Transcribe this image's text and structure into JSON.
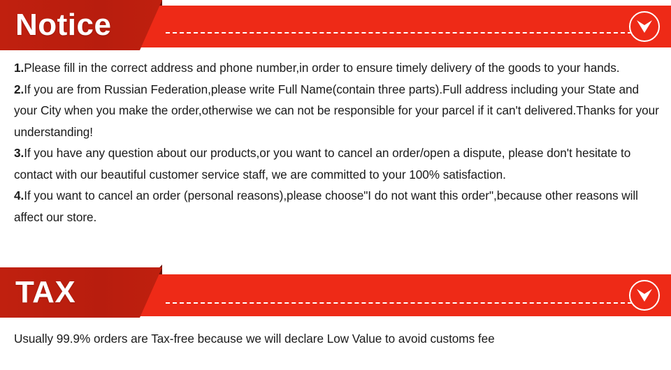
{
  "sections": [
    {
      "id": "notice",
      "title": "Notice",
      "icon": "chevron-down-circle-icon",
      "colors": {
        "flag": "#bf1f0e",
        "bar": "#ee2a17",
        "fold": "#6d0f05",
        "title": "#ffffff"
      },
      "items": [
        {
          "number": "1.",
          "text": "Please fill in the correct address and phone number,in order to ensure timely delivery of the goods to your hands."
        },
        {
          "number": "2.",
          "text": "If you are from Russian Federation,please write Full Name(contain three parts).Full address including your State and your City when you make the order,otherwise we can not be responsible for your parcel if it can't delivered.Thanks for your understanding!"
        },
        {
          "number": "3.",
          "text": "If you have any question about our products,or you want to cancel an order/open a dispute, please don't hesitate to contact with our beautiful customer service staff, we are committed to your 100% satisfaction."
        },
        {
          "number": "4.",
          "text": "If you want to cancel an order (personal reasons),please choose\"I do not want this order\",because other reasons will affect our store."
        }
      ]
    },
    {
      "id": "tax",
      "title": "TAX",
      "icon": "chevron-down-circle-icon",
      "colors": {
        "flag": "#bf1f0e",
        "bar": "#ee2a17",
        "fold": "#6d0f05",
        "title": "#ffffff"
      },
      "items": [
        {
          "number": "",
          "text": "Usually 99.9% orders are Tax-free because we will declare Low Value to avoid customs fee"
        }
      ]
    }
  ]
}
